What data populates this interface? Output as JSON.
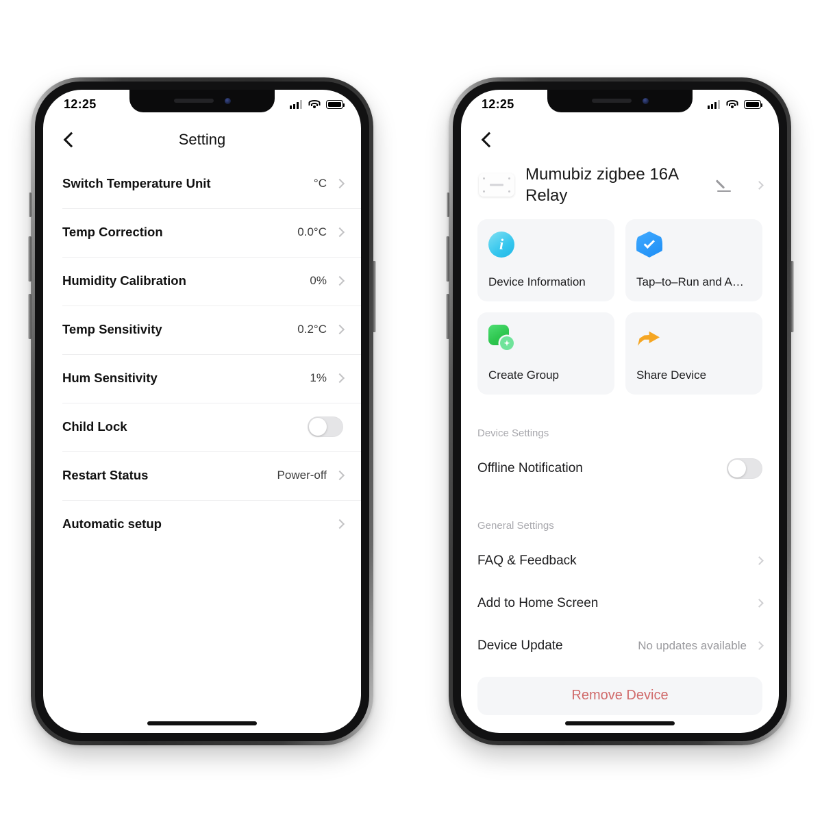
{
  "left_phone": {
    "status_bar": {
      "time": "12:25",
      "signal": "signal-icon",
      "wifi": "wifi-icon",
      "battery": "battery-icon"
    },
    "nav": {
      "back": "back-chevron-icon",
      "title": "Setting"
    },
    "rows": [
      {
        "label": "Switch Temperature Unit",
        "value": "°C",
        "type": "chevron"
      },
      {
        "label": "Temp Correction",
        "value": "0.0°C",
        "type": "chevron"
      },
      {
        "label": "Humidity Calibration",
        "value": "0%",
        "type": "chevron"
      },
      {
        "label": "Temp Sensitivity",
        "value": "0.2°C",
        "type": "chevron"
      },
      {
        "label": "Hum Sensitivity",
        "value": "1%",
        "type": "chevron"
      },
      {
        "label": "Child Lock",
        "value": "",
        "type": "toggle",
        "toggle_on": false
      },
      {
        "label": "Restart Status",
        "value": "Power-off",
        "type": "chevron"
      },
      {
        "label": "Automatic setup",
        "value": "",
        "type": "chevron"
      }
    ]
  },
  "right_phone": {
    "status_bar": {
      "time": "12:25",
      "signal": "signal-icon",
      "wifi": "wifi-icon",
      "battery": "battery-icon"
    },
    "nav": {
      "back": "back-chevron-icon",
      "title": ""
    },
    "device": {
      "name": "Mumubiz zigbee 16A Relay",
      "thumbnail": "relay-module-icon",
      "edit_icon": "pencil-icon",
      "chevron": "chevron-right-icon"
    },
    "cards": [
      {
        "label": "Device Information",
        "icon": "info-circle-icon",
        "color": "#35c6ee"
      },
      {
        "label": "Tap–to–Run and A…",
        "icon": "shield-check-icon",
        "color": "#1e8ef5"
      },
      {
        "label": "Create Group",
        "icon": "create-group-icon",
        "color": "#2fc750"
      },
      {
        "label": "Share Device",
        "icon": "share-arrow-icon",
        "color": "#f5a623"
      }
    ],
    "device_settings": {
      "title": "Device Settings",
      "rows": [
        {
          "label": "Offline Notification",
          "value": "",
          "type": "toggle",
          "toggle_on": false
        }
      ]
    },
    "general_settings": {
      "title": "General Settings",
      "rows": [
        {
          "label": "FAQ & Feedback",
          "value": "",
          "type": "chevron"
        },
        {
          "label": "Add to Home Screen",
          "value": "",
          "type": "chevron"
        },
        {
          "label": "Device Update",
          "value": "No updates available",
          "type": "chevron"
        }
      ]
    },
    "remove_button": {
      "label": "Remove Device",
      "color": "#d06a6a"
    }
  }
}
